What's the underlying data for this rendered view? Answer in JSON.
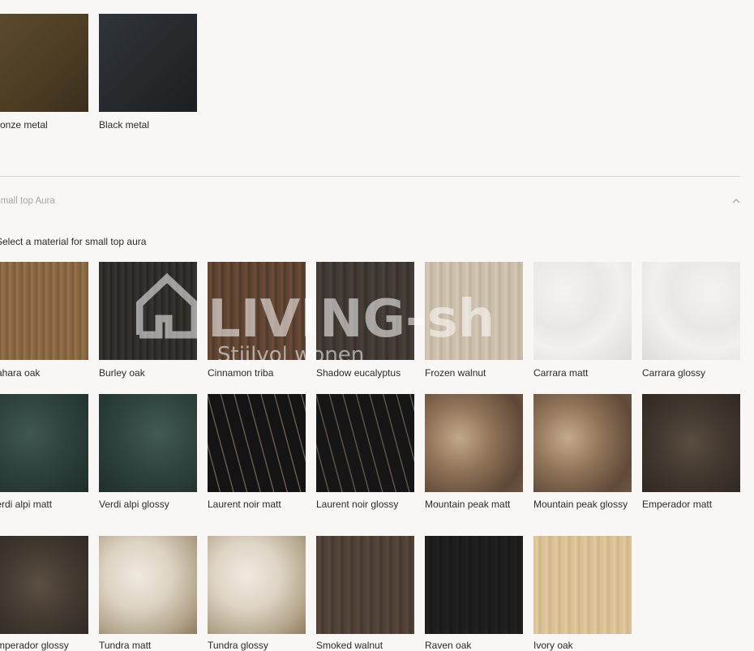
{
  "top_materials": [
    {
      "label": "Bronze metal",
      "color_a": "#5a4a2c",
      "color_b": "#3e3220"
    },
    {
      "label": "Black metal",
      "color_a": "#2c3033",
      "color_b": "#1f2224"
    }
  ],
  "section": {
    "title": "Small top Aura",
    "instruction": "Select a material for small top aura"
  },
  "materials": [
    {
      "label": "Sahara oak"
    },
    {
      "label": "Burley oak"
    },
    {
      "label": "Cinnamon triba"
    },
    {
      "label": "Shadow eucalyptus"
    },
    {
      "label": "Frozen walnut"
    },
    {
      "label": "Carrara matt"
    },
    {
      "label": "Carrara glossy"
    },
    {
      "label": "Verdi alpi matt"
    },
    {
      "label": "Verdi alpi glossy"
    },
    {
      "label": "Laurent noir matt"
    },
    {
      "label": "Laurent noir glossy"
    },
    {
      "label": "Mountain peak matt"
    },
    {
      "label": "Mountain peak glossy"
    },
    {
      "label": "Emperador matt"
    },
    {
      "label": "Emperador glossy"
    },
    {
      "label": "Tundra matt"
    },
    {
      "label": "Tundra glossy"
    },
    {
      "label": "Smoked walnut"
    },
    {
      "label": "Raven oak"
    },
    {
      "label": "Ivory oak"
    }
  ],
  "watermark": {
    "brand": "LIVING-sh",
    "tagline": "Stijlvol wonen"
  },
  "icons": {
    "accordion_toggle": "chevron-up-icon",
    "watermark_logo": "house-icon"
  }
}
